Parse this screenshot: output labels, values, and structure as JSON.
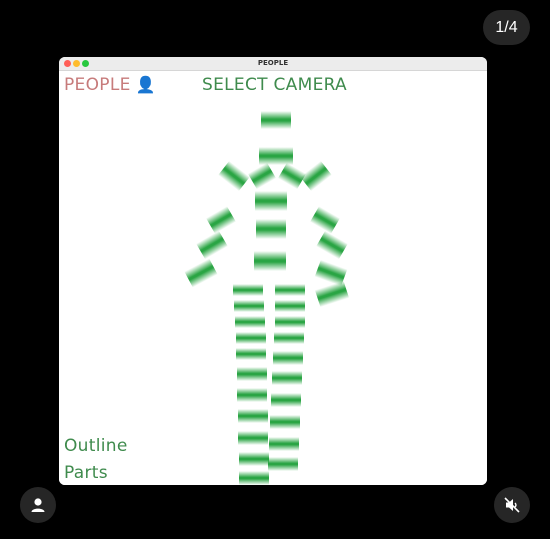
{
  "viewer": {
    "counter": "1/4"
  },
  "window": {
    "title": "PEOPLE"
  },
  "app": {
    "people_label": "PEOPLE",
    "people_icon": "person-silhouette-icon",
    "select_camera_label": "SELECT CAMERA",
    "menu": [
      {
        "label": "Outline"
      },
      {
        "label": "Parts"
      }
    ]
  },
  "colors": {
    "people_label": "#c77b7b",
    "menu_text": "#3f8b4d",
    "stripe_green": "#1fa03a"
  },
  "controls": {
    "profile_icon": "person-icon",
    "mute_icon": "speaker-muted-icon"
  }
}
